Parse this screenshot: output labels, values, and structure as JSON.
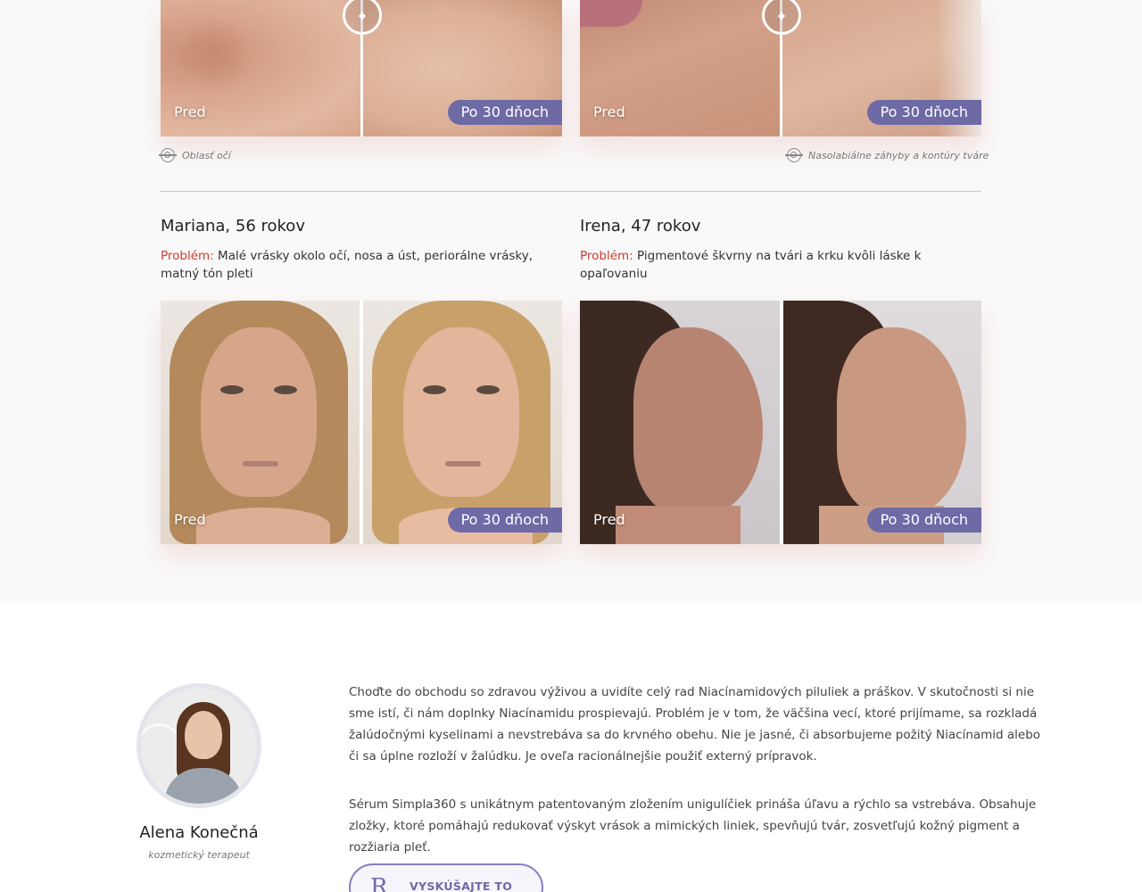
{
  "comparisons_top": [
    {
      "before_label": "Pred",
      "after_label": "Po 30 dňoch",
      "area": "Oblasť očí"
    },
    {
      "before_label": "Pred",
      "after_label": "Po 30 dňoch",
      "area": "Nasolabiálne záhyby a kontúry tváre"
    }
  ],
  "cases": [
    {
      "title": "Mariana, 56 rokov",
      "problem_label": "Problém:",
      "problem_text": "Malé vrásky okolo očí, nosa a úst, periorálne vrásky, matný tón pleti",
      "before_label": "Pred",
      "after_label": "Po 30 dňoch"
    },
    {
      "title": "Irena, 47 rokov",
      "problem_label": "Problém:",
      "problem_text": "Pigmentové škvrny na tvári a krku kvôli láske k opaľovaniu",
      "before_label": "Pred",
      "after_label": "Po 30 dňoch"
    }
  ],
  "expert": {
    "name": "Alena Konečná",
    "role": "kozmetický terapeut"
  },
  "paragraphs": [
    "Choďte do obchodu so zdravou výživou a uvidíte celý rad Niacínamidových piluliek a práškov. V skutočnosti si nie sme istí, či nám doplnky Niacínamidu prospievajú. Problém je v tom, že väčšina vecí, ktoré prijímame, sa rozkladá žalúdočnými kyselinami a nevstrebáva sa do krvného obehu. Nie je jasné, či absorbujeme požitý Niacínamid alebo či sa úplne rozloží v žalúdku. Je oveľa racionálnejšie použiť externý prípravok.",
    "Sérum Simpla360 s unikátnym patentovaným zložením unigulíčiek prináša úľavu a rýchlo sa vstrebáva. Obsahuje zložky, ktoré pomáhajú redukovať výskyt vrások a mimických liniek, spevňujú tvár, zosvetľujú kožný pigment a rozžiaria pleť."
  ],
  "cta": {
    "label": "VYSKÚŠAJTE TO",
    "logo_glyph": "R"
  },
  "colors": {
    "accent": "#6e6aa6",
    "problem": "#d23a2a",
    "section_bg": "#faf9f9"
  }
}
